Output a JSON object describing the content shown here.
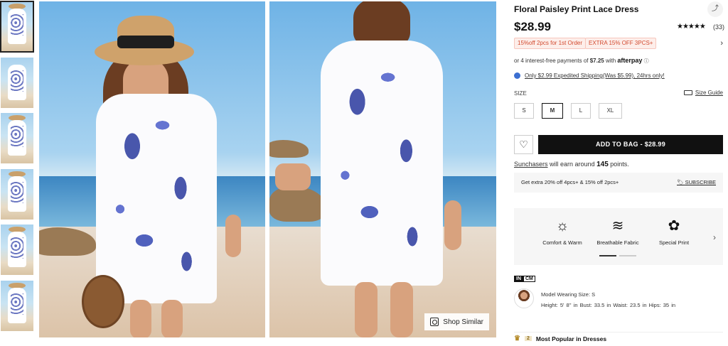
{
  "thumbnails": [
    {
      "label": "thumbnail-1"
    },
    {
      "label": "thumbnail-2"
    },
    {
      "label": "thumbnail-3"
    },
    {
      "label": "thumbnail-4"
    },
    {
      "label": "thumbnail-5"
    },
    {
      "label": "thumbnail-6"
    }
  ],
  "gallery": {
    "shop_similar_label": "Shop Similar"
  },
  "product": {
    "title": "Floral Paisley Print Lace Dress",
    "price": "$28.99",
    "stars": "★★★★★",
    "rating_value": 4.5,
    "review_count": "(33)",
    "promo_1": "15%off 2pcs for 1st Order",
    "promo_2": "EXTRA 15% OFF 3PCS+",
    "afterpay_prefix": "or 4 interest-free payments of ",
    "afterpay_amount": "$7.25",
    "afterpay_with": " with ",
    "afterpay_brand": "afterpay",
    "shipping_text": "Only $2.99 Expedited Shipping(Was $5.99), 24hrs only!",
    "size_label": "SIZE",
    "size_guide": "Size Guide",
    "sizes": [
      "S",
      "M",
      "L",
      "XL"
    ],
    "selected_size": "M",
    "add_to_bag": "ADD TO BAG - $28.99",
    "points_link": "Sunchasers",
    "points_text": " will earn around ",
    "points_value": "145",
    "points_suffix": " points.",
    "extra_offer": "Get extra 20% off 4pcs+ & 15% off 2pcs+",
    "subscribe": "SUBSCRIBE"
  },
  "features": [
    {
      "label": "Comfort & Warm",
      "icon": "sun-icon"
    },
    {
      "label": "Breathable Fabric",
      "icon": "fabric-icon"
    },
    {
      "label": "Special Print",
      "icon": "flower-print-icon"
    }
  ],
  "units": {
    "in": "IN",
    "cm": "CM"
  },
  "model": {
    "wearing_size": "Model Wearing Size: S",
    "measurements": "Height: 5' 8'' in    Bust: 33.5 in    Waist: 23.5 in    Hips: 35 in"
  },
  "popular": {
    "rank": "2",
    "text": "Most Popular in Dresses"
  },
  "colors": {
    "promo_text": "#d24a2f",
    "promo_bg": "#fdeeea",
    "cta_bg": "#111111",
    "accent_blue": "#2a3a9e"
  }
}
